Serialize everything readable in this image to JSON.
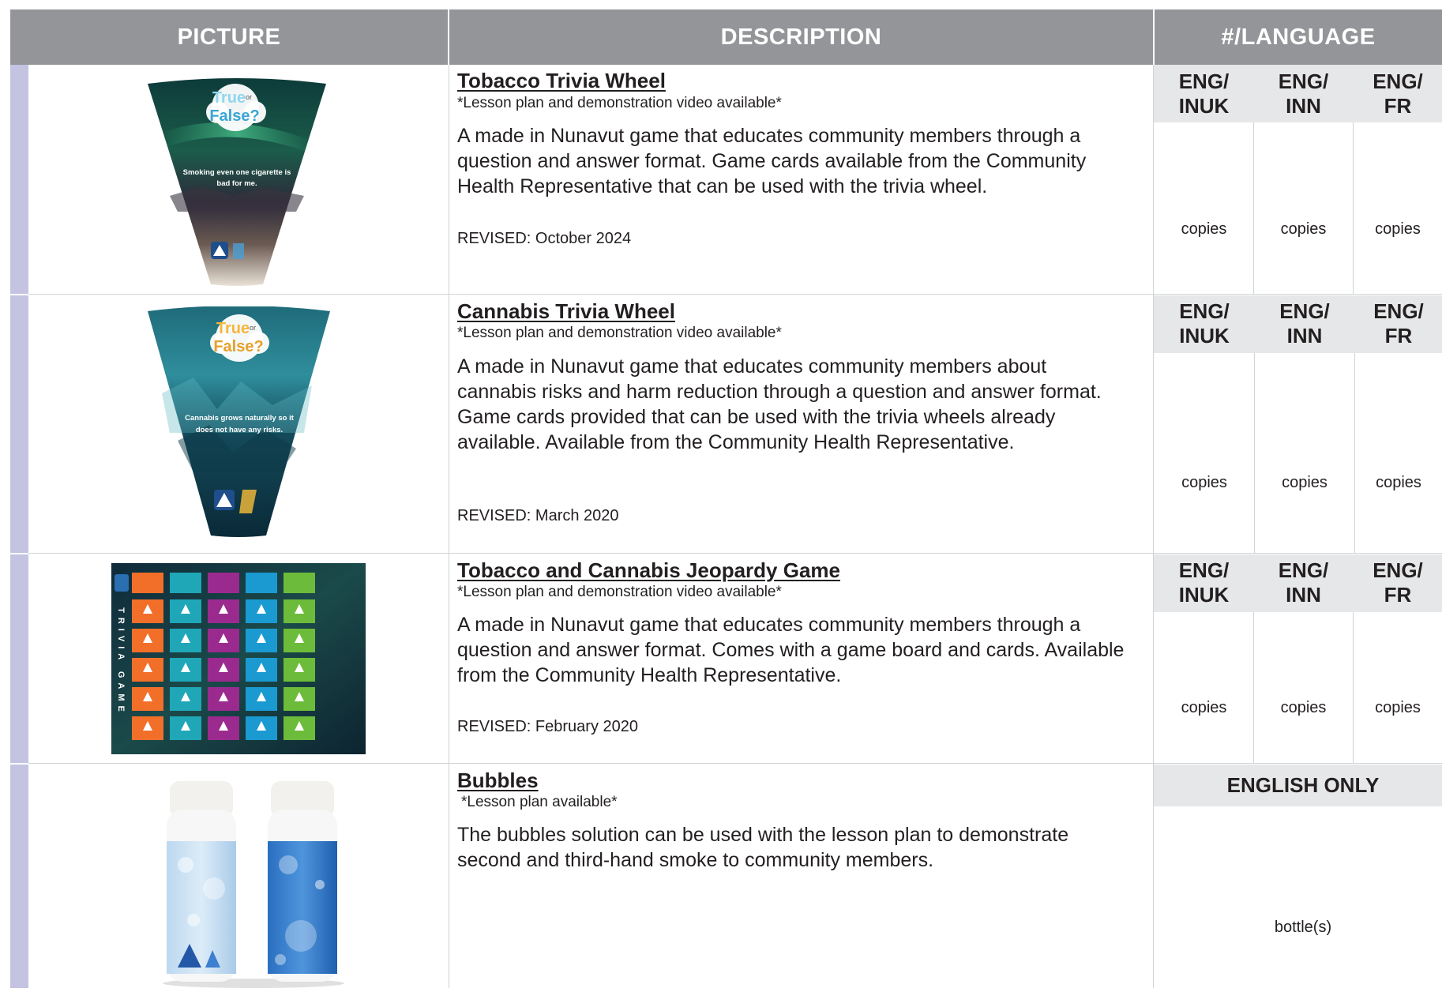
{
  "headers": {
    "picture": "PICTURE",
    "description": "DESCRIPTION",
    "language": "#/LANGUAGE"
  },
  "rows": [
    {
      "title": "Tobacco Trivia Wheel",
      "note": "*Lesson plan and demonstration video available*",
      "description": "A made in Nunavut game that educates community members through a question and answer format. Game cards available from the Community Health Representative that can be used with the trivia wheel.",
      "revised": "REVISED: October 2024",
      "languages": [
        "ENG/ INUK",
        "ENG/ INN",
        "ENG/ FR"
      ],
      "unit": "copies",
      "image": {
        "top_text": "True",
        "mid_text": "or",
        "bottom_text": "False?",
        "caption": "Smoking even one cigarette is bad for me."
      }
    },
    {
      "title": "Cannabis Trivia Wheel",
      "note": "*Lesson plan and demonstration video available*",
      "description": "A made in Nunavut game that educates community members about cannabis risks and harm reduction through a question and answer format. Game cards provided that can be used with the trivia wheels already available. Available from the Community Health Representative.",
      "revised": "REVISED: March 2020",
      "languages": [
        "ENG/ INUK",
        "ENG/ INN",
        "ENG/ FR"
      ],
      "unit": "copies",
      "image": {
        "top_text": "True",
        "mid_text": "or",
        "bottom_text": "False?",
        "caption": "Cannabis grows naturally so it does not have any risks."
      }
    },
    {
      "title": "Tobacco and Cannabis Jeopardy Game",
      "note": "*Lesson plan and demonstration video available*",
      "description": "A made in Nunavut game that educates community members through a question and answer format. Comes with a game board and cards. Available from the Community Health Representative.",
      "revised": "REVISED: February 2020",
      "languages": [
        "ENG/ INUK",
        "ENG/ INN",
        "ENG/ FR"
      ],
      "unit": "copies",
      "image": {
        "side_left": "TRIVIA GAME"
      }
    },
    {
      "title": "Bubbles",
      "note": "*Lesson plan available*",
      "description": "The bubbles solution can be used with the lesson plan to demonstrate second and third-hand smoke to community members.",
      "languages": [
        "ENGLISH ONLY"
      ],
      "unit": "bottle(s)"
    }
  ],
  "colors": {
    "header_bg": "#939598",
    "row_strip": "#c5c3e2",
    "lang_bar": "#e6e7e8",
    "grid": "#d1d3d4"
  }
}
